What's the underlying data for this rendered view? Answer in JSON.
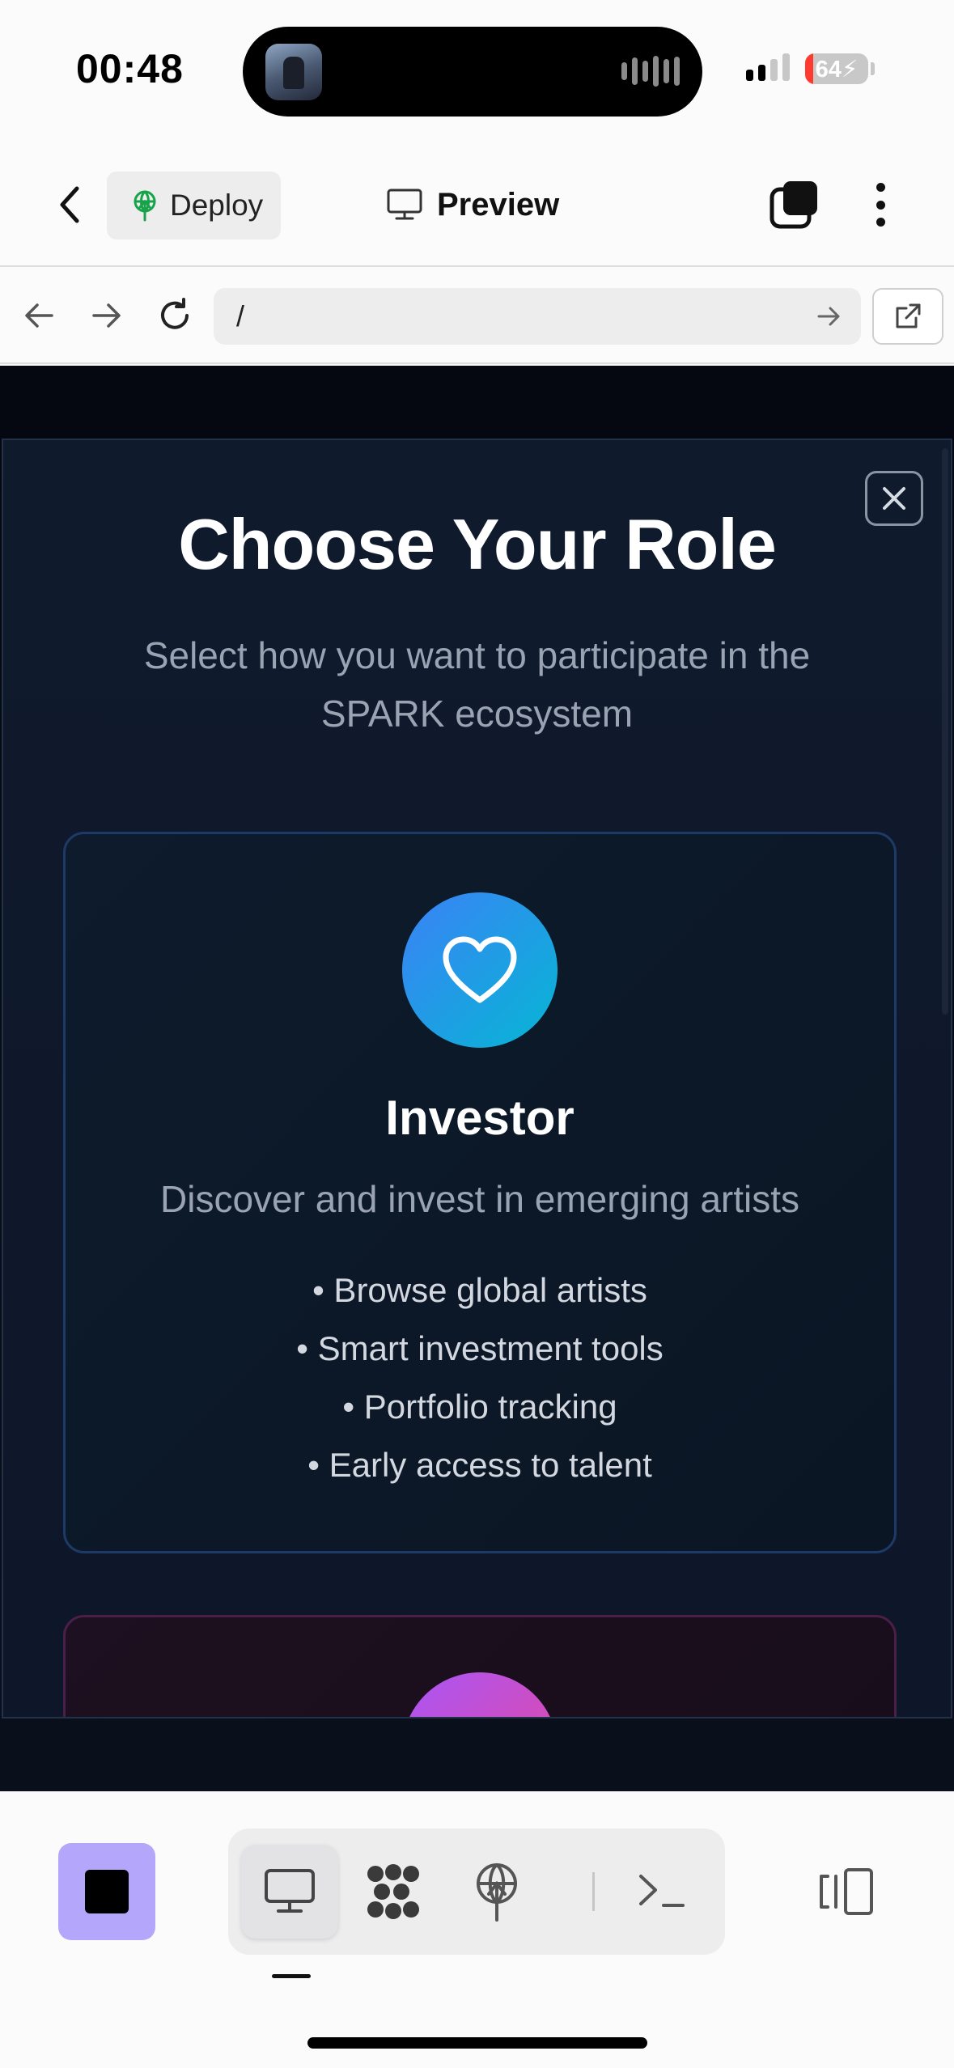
{
  "status_bar": {
    "time": "00:48",
    "battery_level": "64",
    "battery_charging": true
  },
  "app_header": {
    "back_icon": "chevron-left-icon",
    "deploy_label": "Deploy",
    "deploy_icon": "deploy-antenna-icon",
    "preview_label": "Preview",
    "preview_icon": "monitor-icon",
    "tabs_icon": "tabs-stack-icon",
    "menu_icon": "vertical-dots-icon"
  },
  "browser_bar": {
    "url": "/",
    "back_icon": "arrow-left-icon",
    "forward_icon": "arrow-right-icon",
    "reload_icon": "reload-icon",
    "go_icon": "arrow-right-icon",
    "external_icon": "external-link-icon"
  },
  "modal": {
    "title": "Choose Your Role",
    "subtitle": "Select how you want to participate in the SPARK ecosystem",
    "close_icon": "close-icon",
    "roles": [
      {
        "name": "Investor",
        "description": "Discover and invest in emerging artists",
        "icon": "heart-icon",
        "accent_from": "#3b82f6",
        "accent_to": "#06b6d4",
        "features": [
          "• Browse global artists",
          "• Smart investment tools",
          "• Portfolio tracking",
          "• Early access to talent"
        ]
      },
      {
        "icon": "artist-role-icon",
        "accent_from": "#a855f7",
        "accent_to": "#ec4899"
      }
    ]
  },
  "toolbar": {
    "stop_color": "#b4a6fb",
    "items": [
      {
        "icon": "monitor-icon",
        "active": true
      },
      {
        "icon": "dots-cluster-icon",
        "active": false
      },
      {
        "icon": "deploy-antenna-icon",
        "active": false
      },
      {
        "icon": "terminal-icon",
        "active": false
      }
    ],
    "panel_icon": "split-panel-icon"
  }
}
